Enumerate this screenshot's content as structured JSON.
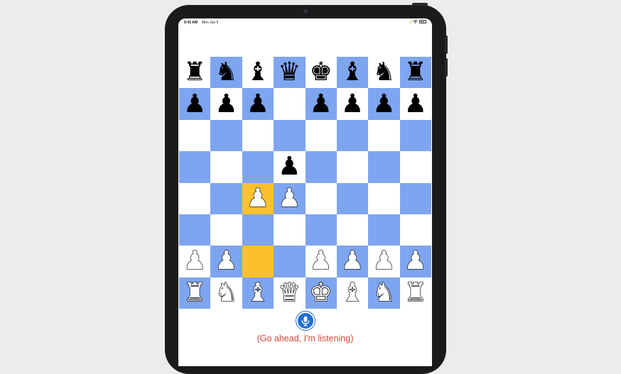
{
  "status_bar": {
    "time": "9:41 AM",
    "date": "Mon Jun 5",
    "indicator_color": "#e6a100"
  },
  "board": {
    "light_color": "#ffffff",
    "dark_color": "#7ea5ef",
    "highlight_color": "#fbc02d",
    "highlighted_squares": [
      "c4",
      "c2"
    ],
    "rows": [
      [
        "r",
        "n",
        "b",
        "q",
        "k",
        "b",
        "n",
        "r"
      ],
      [
        "p",
        "p",
        "p",
        "",
        "p",
        "p",
        "p",
        "p"
      ],
      [
        "",
        "",
        "",
        "",
        "",
        "",
        "",
        ""
      ],
      [
        "",
        "",
        "",
        "p",
        "",
        "",
        "",
        ""
      ],
      [
        "",
        "",
        "P",
        "P",
        "",
        "",
        "",
        ""
      ],
      [
        "",
        "",
        "",
        "",
        "",
        "",
        "",
        ""
      ],
      [
        "P",
        "P",
        "",
        "",
        "P",
        "P",
        "P",
        "P"
      ],
      [
        "R",
        "N",
        "B",
        "Q",
        "K",
        "B",
        "N",
        "R"
      ]
    ]
  },
  "voice": {
    "mic_icon": "microphone-icon",
    "listening_text": "(Go ahead, I'm listening)"
  }
}
